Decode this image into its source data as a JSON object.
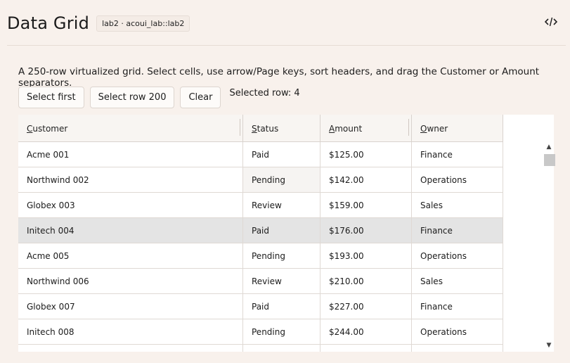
{
  "header": {
    "title": "Data Grid",
    "badge": "lab2 · acoui_lab::lab2",
    "code_icon": "code-icon"
  },
  "description": "A 250-row virtualized grid. Select cells, use arrow/Page keys, sort headers, and drag the Customer or Amount separators.",
  "toolbar": {
    "select_first": "Select first",
    "select_row_200": "Select row 200",
    "clear": "Clear",
    "selected_row": "Selected row: 4"
  },
  "grid": {
    "columns": [
      {
        "key": "C",
        "rest": "ustomer"
      },
      {
        "key": "S",
        "rest": "tatus"
      },
      {
        "key": "A",
        "rest": "mount"
      },
      {
        "key": "O",
        "rest": "wner"
      }
    ],
    "rows": [
      [
        "Acme 001",
        "Paid",
        "$125.00",
        "Finance"
      ],
      [
        "Northwind 002",
        "Pending",
        "$142.00",
        "Operations"
      ],
      [
        "Globex 003",
        "Review",
        "$159.00",
        "Sales"
      ],
      [
        "Initech 004",
        "Paid",
        "$176.00",
        "Finance"
      ],
      [
        "Acme 005",
        "Pending",
        "$193.00",
        "Operations"
      ],
      [
        "Northwind 006",
        "Review",
        "$210.00",
        "Sales"
      ],
      [
        "Globex 007",
        "Paid",
        "$227.00",
        "Finance"
      ],
      [
        "Initech 008",
        "Pending",
        "$244.00",
        "Operations"
      ],
      [
        "",
        "",
        "",
        ""
      ]
    ],
    "selected_row_index": 3
  },
  "scrollbar": {
    "up_glyph": "▲",
    "down_glyph": "▼"
  }
}
